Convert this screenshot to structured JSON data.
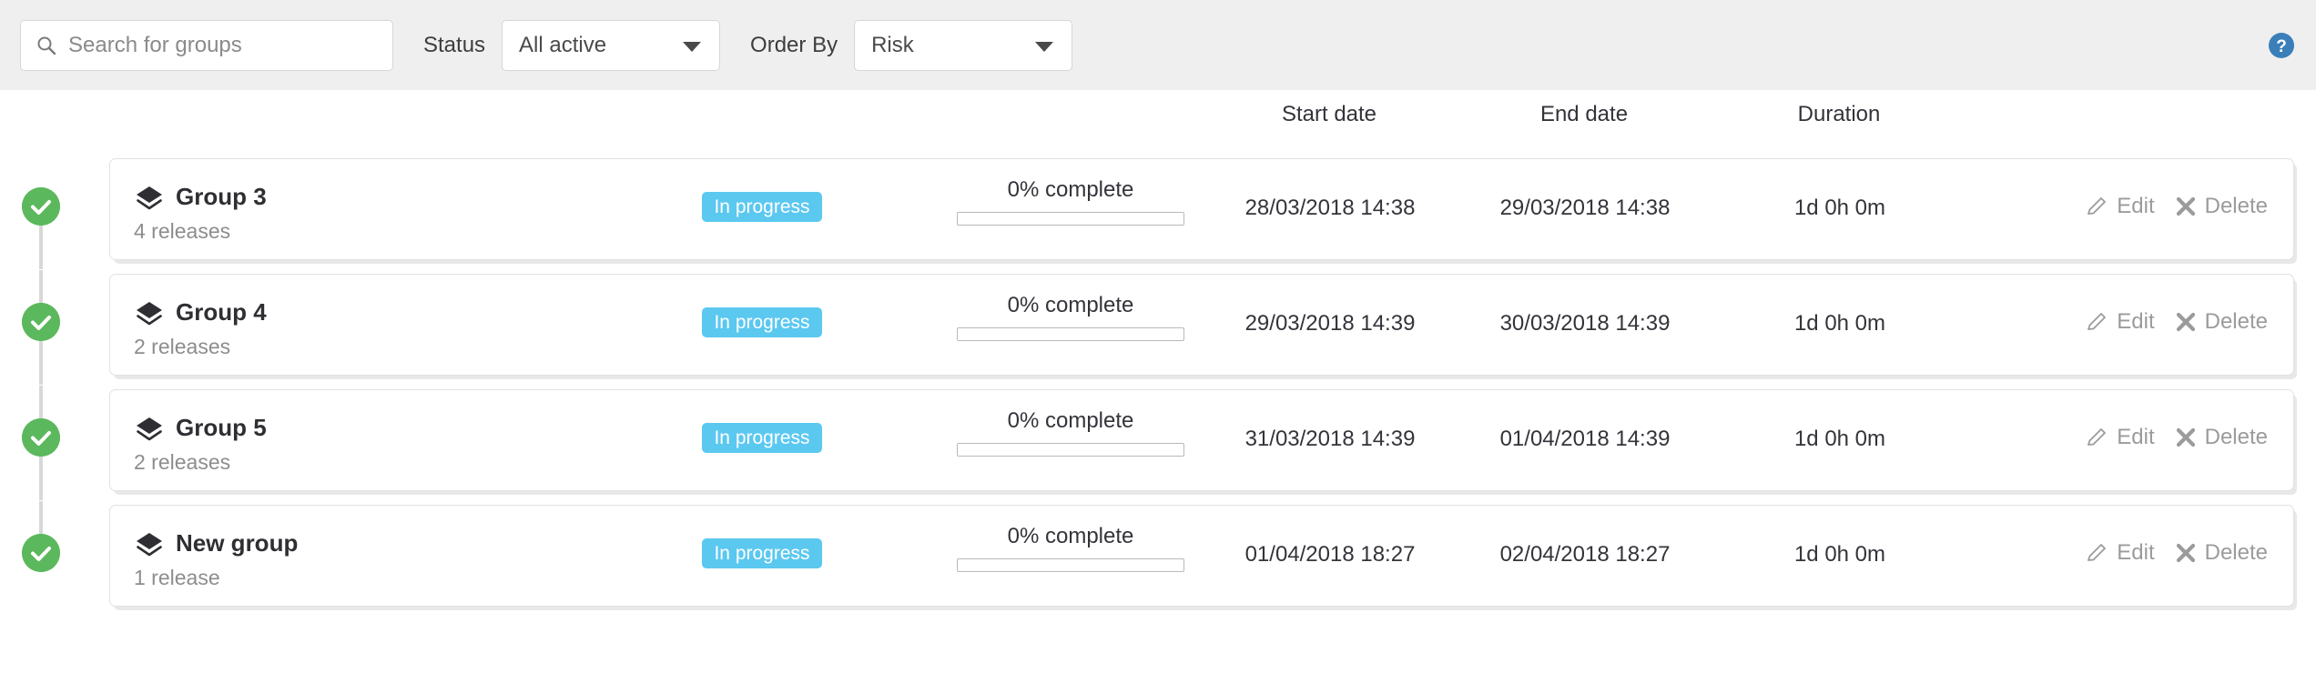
{
  "toolbar": {
    "search": {
      "icon": "search-icon",
      "placeholder": "Search for groups",
      "value": ""
    },
    "status_filter": {
      "label": "Status",
      "selected": "All active",
      "caret_icon": "chevron-down-icon"
    },
    "order_by_filter": {
      "label": "Order By",
      "selected": "Risk",
      "caret_icon": "chevron-down-icon"
    },
    "help": {
      "icon": "help-circle-icon",
      "color": "#3a7fba"
    }
  },
  "columns": {
    "start_date": "Start date",
    "end_date": "End date",
    "duration": "Duration"
  },
  "colors": {
    "toolbar_bg": "#efefef",
    "badge_in_progress": "#5bc8f0",
    "status_ok": "#5cb85c",
    "timeline": "#d8d8d8",
    "text": "#33333a",
    "muted": "#8d8d8d"
  },
  "rows": [
    {
      "status_icon": "check-circle-icon",
      "group_icon": "layers-icon",
      "name": "Group 3",
      "releases": "4 releases",
      "badge": "In progress",
      "progress_label": "0% complete",
      "progress_percent": 0,
      "start_date": "28/03/2018 14:38",
      "end_date": "29/03/2018 14:38",
      "duration": "1d 0h 0m",
      "edit_label": "Edit",
      "edit_icon": "pencil-icon",
      "delete_label": "Delete",
      "delete_icon": "close-x-icon"
    },
    {
      "status_icon": "check-circle-icon",
      "group_icon": "layers-icon",
      "name": "Group 4",
      "releases": "2 releases",
      "badge": "In progress",
      "progress_label": "0% complete",
      "progress_percent": 0,
      "start_date": "29/03/2018 14:39",
      "end_date": "30/03/2018 14:39",
      "duration": "1d 0h 0m",
      "edit_label": "Edit",
      "edit_icon": "pencil-icon",
      "delete_label": "Delete",
      "delete_icon": "close-x-icon"
    },
    {
      "status_icon": "check-circle-icon",
      "group_icon": "layers-icon",
      "name": "Group 5",
      "releases": "2 releases",
      "badge": "In progress",
      "progress_label": "0% complete",
      "progress_percent": 0,
      "start_date": "31/03/2018 14:39",
      "end_date": "01/04/2018 14:39",
      "duration": "1d 0h 0m",
      "edit_label": "Edit",
      "edit_icon": "pencil-icon",
      "delete_label": "Delete",
      "delete_icon": "close-x-icon"
    },
    {
      "status_icon": "check-circle-icon",
      "group_icon": "layers-icon",
      "name": "New group",
      "releases": "1 release",
      "badge": "In progress",
      "progress_label": "0% complete",
      "progress_percent": 0,
      "start_date": "01/04/2018 18:27",
      "end_date": "02/04/2018 18:27",
      "duration": "1d 0h 0m",
      "edit_label": "Edit",
      "edit_icon": "pencil-icon",
      "delete_label": "Delete",
      "delete_icon": "close-x-icon"
    }
  ]
}
